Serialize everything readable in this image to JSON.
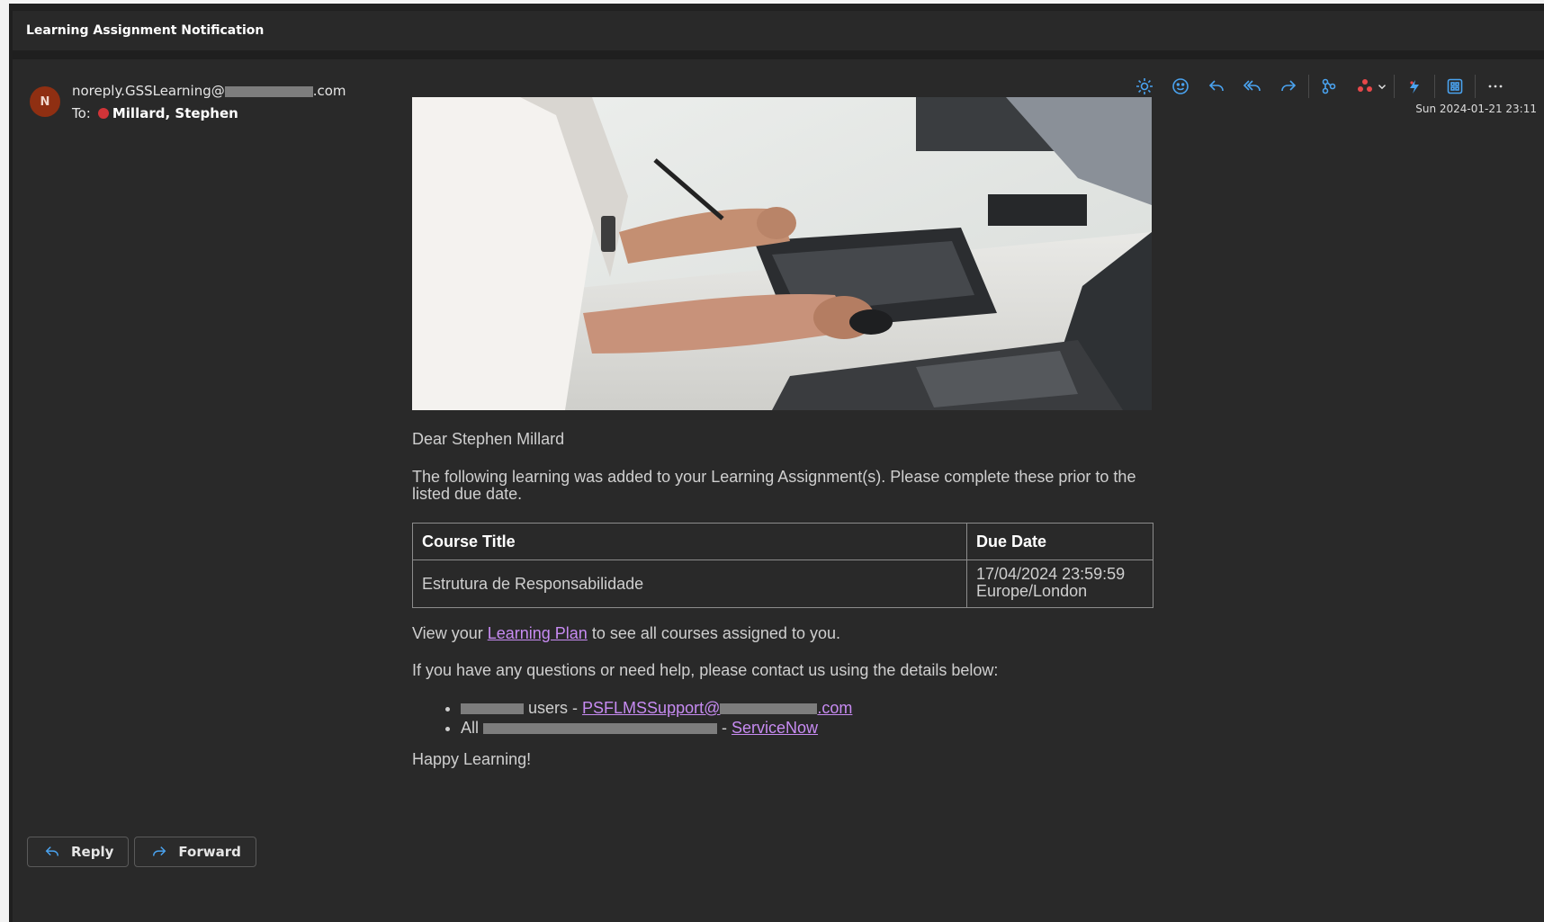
{
  "window": {
    "title": "Learning Assignment Notification"
  },
  "message": {
    "avatar_initial": "N",
    "sender_prefix": "noreply.GSSLearning@",
    "sender_suffix": ".com",
    "to_label": "To:",
    "recipient": "Millard, Stephen",
    "date": "Sun 2024-01-21 23:11"
  },
  "toolbar": {
    "icons": [
      "brightness-icon",
      "emoji-icon",
      "reply-icon",
      "reply-all-icon",
      "forward-icon",
      "apps-icon",
      "loop-icon",
      "chevron-down-icon",
      "teams-icon",
      "grid-icon",
      "more-icon"
    ]
  },
  "body": {
    "greeting": "Dear Stephen Millard",
    "intro": "The following learning was added to your Learning Assignment(s). Please complete these prior to the listed due date.",
    "table": {
      "headers": [
        "Course Title",
        "Due Date"
      ],
      "rows": [
        {
          "title": "Estrutura de Responsabilidade",
          "due_line1": "17/04/2024 23:59:59",
          "due_line2": "Europe/London"
        }
      ]
    },
    "view_prefix": "View your ",
    "view_link": "Learning Plan",
    "view_suffix": " to see all courses assigned to you.",
    "questions": "If you have any questions or need help, please contact us using the details below:",
    "contacts": [
      {
        "text": "users - ",
        "link_prefix": "PSFLMSSupport@",
        "link_suffix": ".com"
      },
      {
        "text_prefix": "All ",
        "text_suffix": " - ",
        "link": "ServiceNow"
      }
    ],
    "signoff": "Happy Learning!"
  },
  "footer": {
    "reply_label": "Reply",
    "forward_label": "Forward"
  },
  "colors": {
    "accent": "#4aa3f0",
    "link": "#c78bf2",
    "avatar": "#8f2f12",
    "presence_busy": "#d13438"
  }
}
